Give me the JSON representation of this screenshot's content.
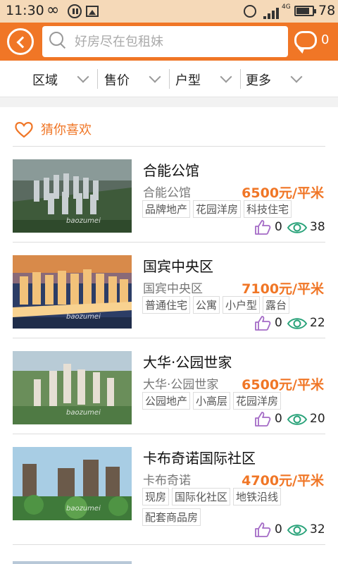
{
  "status": {
    "time": "11:30",
    "network": "4G",
    "battery": "78"
  },
  "header": {
    "search_placeholder": "好房尽在包租妹",
    "messages_count": "0"
  },
  "filters": [
    "区域",
    "售价",
    "户型",
    "更多"
  ],
  "section_title": "猜你喜欢",
  "watermark": "baozumei",
  "listings": [
    {
      "title": "合能公馆",
      "subtitle": "合能公馆",
      "price": "6500元/平米",
      "tags": [
        "品牌地产",
        "花园洋房",
        "科技住宅"
      ],
      "likes": "0",
      "views": "38"
    },
    {
      "title": "国宾中央区",
      "subtitle": "国宾中央区",
      "price": "7100元/平米",
      "tags": [
        "普通住宅",
        "公寓",
        "小户型",
        "露台"
      ],
      "likes": "0",
      "views": "22"
    },
    {
      "title": "大华·公园世家",
      "subtitle": "大华·公园世家",
      "price": "6500元/平米",
      "tags": [
        "公园地产",
        "小高层",
        "花园洋房"
      ],
      "likes": "0",
      "views": "20"
    },
    {
      "title": "卡布奇诺国际社区",
      "subtitle": "卡布奇诺",
      "price": "4700元/平米",
      "tags": [
        "现房",
        "国际化社区",
        "地铁沿线",
        "配套商品房"
      ],
      "likes": "0",
      "views": "32"
    }
  ],
  "colors": {
    "accent": "#f07626",
    "statusbar": "#f5d9b8",
    "like_icon": "#a46bc6",
    "view_icon": "#2aa37a"
  }
}
